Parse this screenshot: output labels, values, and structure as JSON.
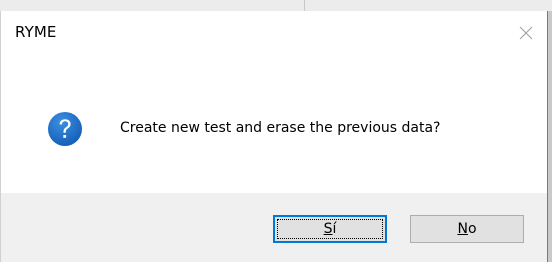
{
  "window": {
    "title": "RYME"
  },
  "dialog": {
    "icon": "question-icon",
    "message": "Create new test and erase the previous data?",
    "icon_color": "#1a6fc4"
  },
  "buttons": {
    "yes_first": "S",
    "yes_rest": "í",
    "no_first": "N",
    "no_rest": "o"
  },
  "colors": {
    "focus_border": "#0078d7",
    "footer_bg": "#f0f0f0",
    "button_bg": "#e1e1e1"
  }
}
